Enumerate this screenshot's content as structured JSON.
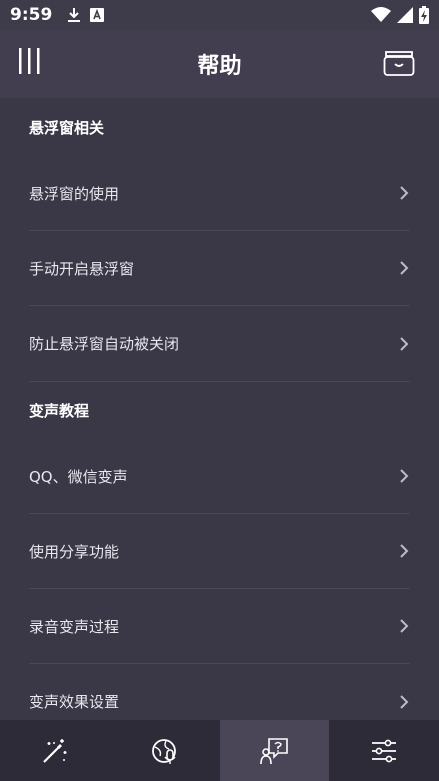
{
  "status_bar": {
    "time": "9:59",
    "icons": [
      "download-icon",
      "a-box-icon",
      "wifi-icon",
      "signal-icon",
      "battery-charging-icon"
    ]
  },
  "app_bar": {
    "title": "帮助",
    "left_icon": "menu-icon",
    "right_icon": "folder-icon"
  },
  "sections": [
    {
      "title": "悬浮窗相关",
      "items": [
        {
          "label": "悬浮窗的使用"
        },
        {
          "label": "手动开启悬浮窗"
        },
        {
          "label": "防止悬浮窗自动被关闭"
        }
      ]
    },
    {
      "title": "变声教程",
      "items": [
        {
          "label": "QQ、微信变声"
        },
        {
          "label": "使用分享功能"
        },
        {
          "label": "录音变声过程"
        },
        {
          "label": "变声效果设置"
        }
      ]
    }
  ],
  "bottom_nav": {
    "tabs": [
      {
        "icon": "magic-wand-icon",
        "active": false
      },
      {
        "icon": "globe-mic-icon",
        "active": false
      },
      {
        "icon": "help-chat-icon",
        "active": true
      },
      {
        "icon": "sliders-icon",
        "active": false
      }
    ]
  },
  "colors": {
    "background": "#3a3746",
    "app_bar": "#423e50",
    "bottom_nav": "#2e2b39",
    "active_tab": "#4a4658",
    "text": "#ffffff"
  }
}
